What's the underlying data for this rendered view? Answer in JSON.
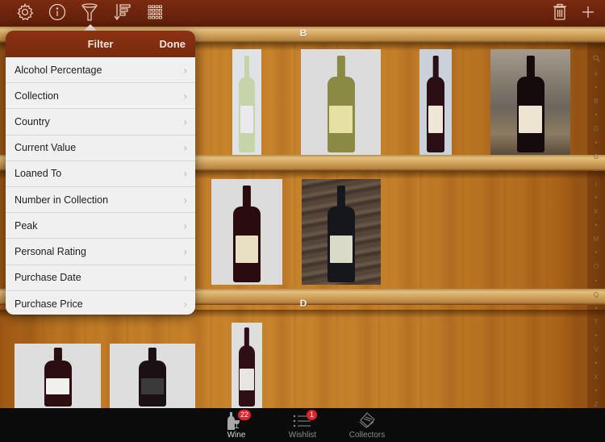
{
  "toolbar": {
    "left_icons": [
      "gear-icon",
      "info-icon",
      "filter-funnel-icon",
      "sort-icon",
      "grid-view-icon"
    ],
    "right_icons": [
      "trash-icon",
      "plus-icon"
    ]
  },
  "shelves": [
    {
      "letter": "B"
    },
    {
      "letter": ""
    },
    {
      "letter": "D"
    }
  ],
  "index": [
    "search",
    "#",
    "•",
    "B",
    "•",
    "D",
    "•",
    "G",
    "•",
    "I",
    "•",
    "K",
    "•",
    "M",
    "•",
    "O",
    "•",
    "Q",
    "•",
    "T",
    "•",
    "V",
    "•",
    "X",
    "•",
    "Z"
  ],
  "popover": {
    "title": "Filter",
    "done_label": "Done",
    "items": [
      {
        "label": "Alcohol Percentage"
      },
      {
        "label": "Collection"
      },
      {
        "label": "Country"
      },
      {
        "label": "Current Value"
      },
      {
        "label": "Loaned To"
      },
      {
        "label": "Number in Collection"
      },
      {
        "label": "Peak"
      },
      {
        "label": "Personal Rating"
      },
      {
        "label": "Purchase Date"
      },
      {
        "label": "Purchase Price"
      }
    ]
  },
  "wines": [
    {
      "shelf": 1,
      "bottle_color": "#c7d3a8",
      "label_color": "#e9e9ef",
      "kind": "white-wine"
    },
    {
      "shelf": 1,
      "bottle_color": "#8b8a45",
      "label_color": "#e6e0a3",
      "kind": "white-wine"
    },
    {
      "shelf": 1,
      "bottle_color": "#2a0f14",
      "label_color": "#efe6d6",
      "kind": "red-wine"
    },
    {
      "shelf": 1,
      "bottle_color": "#150a0c",
      "label_color": "#ede4d2",
      "kind": "red-wine"
    },
    {
      "shelf": 2,
      "bottle_color": "#2a0c10",
      "label_color": "#e9dfc3",
      "kind": "red-wine"
    },
    {
      "shelf": 2,
      "bottle_color": "#16171d",
      "label_color": "#d9dbc8",
      "kind": "red-wine"
    },
    {
      "shelf": 3,
      "bottle_color": "#2b0d12",
      "label_color": "#f2f0ec",
      "kind": "red-wine"
    },
    {
      "shelf": 3,
      "bottle_color": "#1b1115",
      "label_color": "#3a3a3a",
      "kind": "red-wine"
    },
    {
      "shelf": 3,
      "bottle_color": "#2e0f16",
      "label_color": "#e8e6e2",
      "kind": "red-wine"
    }
  ],
  "tabs": [
    {
      "label": "Wine",
      "icon": "wine-bottle-glass-icon",
      "badge": "22",
      "active": true
    },
    {
      "label": "Wishlist",
      "icon": "list-icon",
      "badge": "1",
      "active": false
    },
    {
      "label": "Collectors",
      "icon": "collectors-icon",
      "badge": "",
      "active": false
    }
  ],
  "colors": {
    "toolbar_bg": "#6a230c",
    "badge": "#e0232a",
    "tabbar_bg": "#0b0b0b"
  }
}
